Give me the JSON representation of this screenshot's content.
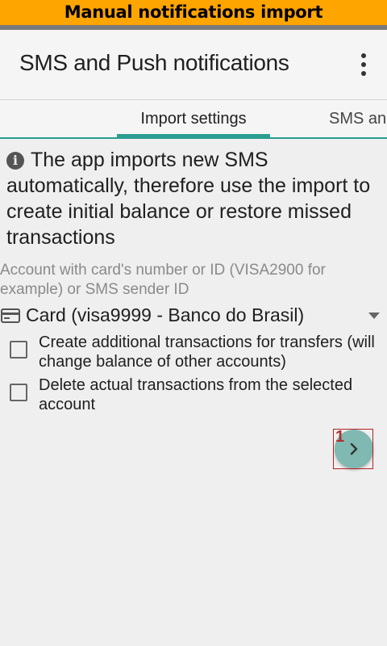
{
  "banner": {
    "text": "Manual notifications import"
  },
  "appbar": {
    "title": "SMS and Push notifications",
    "menu_icon": "overflow-dots-icon"
  },
  "tabs": [
    {
      "label": "Import settings",
      "active": true
    },
    {
      "label": "SMS and",
      "active": false
    }
  ],
  "info": {
    "icon": "info-icon",
    "text": "The app imports new SMS automatically, therefore use the import to create initial balance or restore missed transactions"
  },
  "account": {
    "label": "Account with card's number or ID (VISA2900 for example) or SMS sender ID",
    "icon": "card-icon",
    "selected": "Card (visa9999 - Banco do Brasil)"
  },
  "options": [
    {
      "label": "Create additional transactions for transfers (will change balance of other accounts)",
      "checked": false
    },
    {
      "label": "Delete actual transactions from the selected account",
      "checked": false
    }
  ],
  "next": {
    "icon": "chevron-right-icon",
    "badge": "1"
  },
  "colors": {
    "banner": "#ffa500",
    "accent": "#2a9d90",
    "fab": "#7fb9b1",
    "highlight": "#b22222"
  }
}
